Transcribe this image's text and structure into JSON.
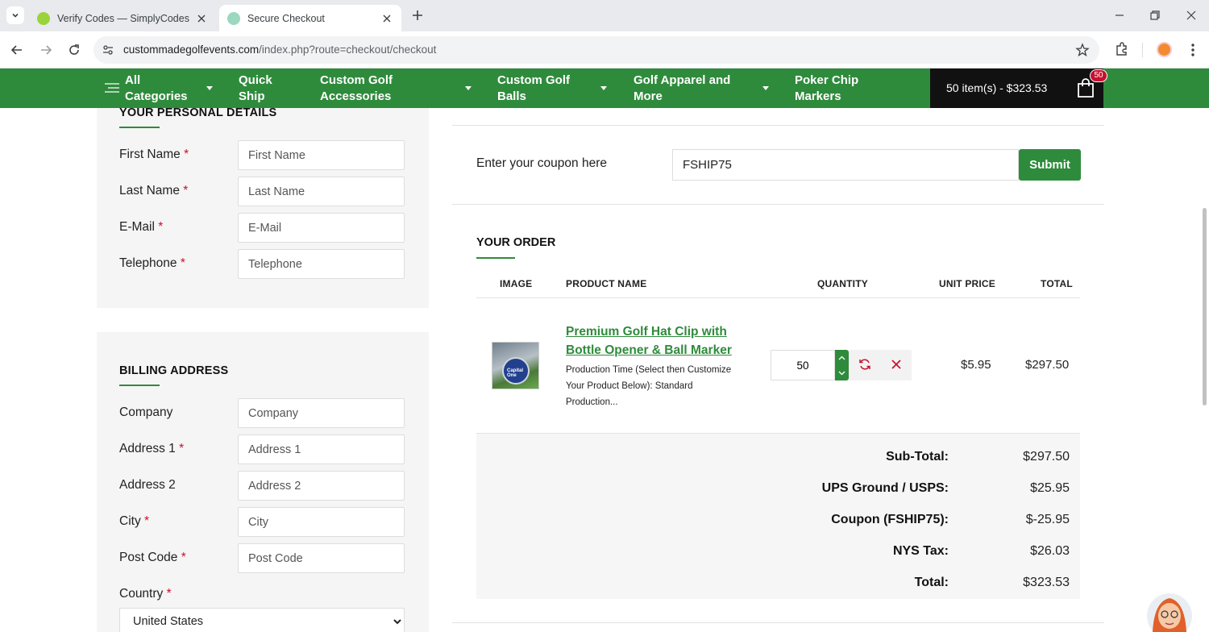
{
  "browser": {
    "tabs": [
      {
        "title": "Verify Codes — SimplyCodes",
        "active": false,
        "favicon_color": "#9bd33a"
      },
      {
        "title": "Secure Checkout",
        "active": true,
        "favicon_color": "#9ad8c0"
      }
    ],
    "url_host": "custommadegolfevents.com",
    "url_path": "/index.php?route=checkout/checkout"
  },
  "nav": {
    "items": [
      {
        "label_line1": "All",
        "label_line2": "Categories",
        "dropdown": true
      },
      {
        "label_line1": "Quick",
        "label_line2": "Ship",
        "dropdown": false
      },
      {
        "label_line1": "Custom Golf",
        "label_line2": "Accessories",
        "dropdown": true
      },
      {
        "label_line1": "Custom Golf",
        "label_line2": "Balls",
        "dropdown": true
      },
      {
        "label_line1": "Golf Apparel and",
        "label_line2": "More",
        "dropdown": true
      },
      {
        "label_line1": "Poker Chip",
        "label_line2": "Markers",
        "dropdown": false
      }
    ],
    "cart_summary": "50 item(s) - $323.53",
    "cart_badge": "50",
    "brand_color": "#2f8b3c"
  },
  "personal": {
    "title": "YOUR PERSONAL DETAILS",
    "fields": [
      {
        "label": "First Name",
        "required": "*",
        "placeholder": "First Name"
      },
      {
        "label": "Last Name",
        "required": "*",
        "placeholder": "Last Name"
      },
      {
        "label": "E-Mail",
        "required": "*",
        "placeholder": "E-Mail"
      },
      {
        "label": "Telephone",
        "required": "*",
        "placeholder": "Telephone"
      }
    ]
  },
  "billing": {
    "title": "BILLING ADDRESS",
    "fields": [
      {
        "label": "Company",
        "required": "",
        "placeholder": "Company"
      },
      {
        "label": "Address 1",
        "required": "*",
        "placeholder": "Address 1"
      },
      {
        "label": "Address 2",
        "required": "",
        "placeholder": "Address 2"
      },
      {
        "label": "City",
        "required": "*",
        "placeholder": "City"
      },
      {
        "label": "Post Code",
        "required": "*",
        "placeholder": "Post Code"
      }
    ],
    "country_label": "Country",
    "country_required": "*",
    "country_value": "United States"
  },
  "coupon": {
    "label": "Enter your coupon here",
    "value": "FSHIP75",
    "submit": "Submit"
  },
  "order": {
    "title": "YOUR ORDER",
    "columns": [
      "IMAGE",
      "PRODUCT NAME",
      "QUANTITY",
      "UNIT PRICE",
      "TOTAL"
    ],
    "item": {
      "name": "Premium Golf Hat Clip with Bottle Opener & Ball Marker",
      "option": "Production Time (Select then Customize Your Product Below): Standard Production...",
      "quantity": "50",
      "unit_price": "$5.95",
      "total": "$297.50",
      "image_text": "Capital One"
    },
    "totals": [
      {
        "label": "Sub-Total:",
        "value": "$297.50"
      },
      {
        "label": "UPS Ground / USPS:",
        "value": "$25.95"
      },
      {
        "label": "Coupon (FSHIP75):",
        "value": "$-25.95"
      },
      {
        "label": "NYS Tax:",
        "value": "$26.03"
      },
      {
        "label": "Total:",
        "value": "$323.53"
      }
    ]
  }
}
